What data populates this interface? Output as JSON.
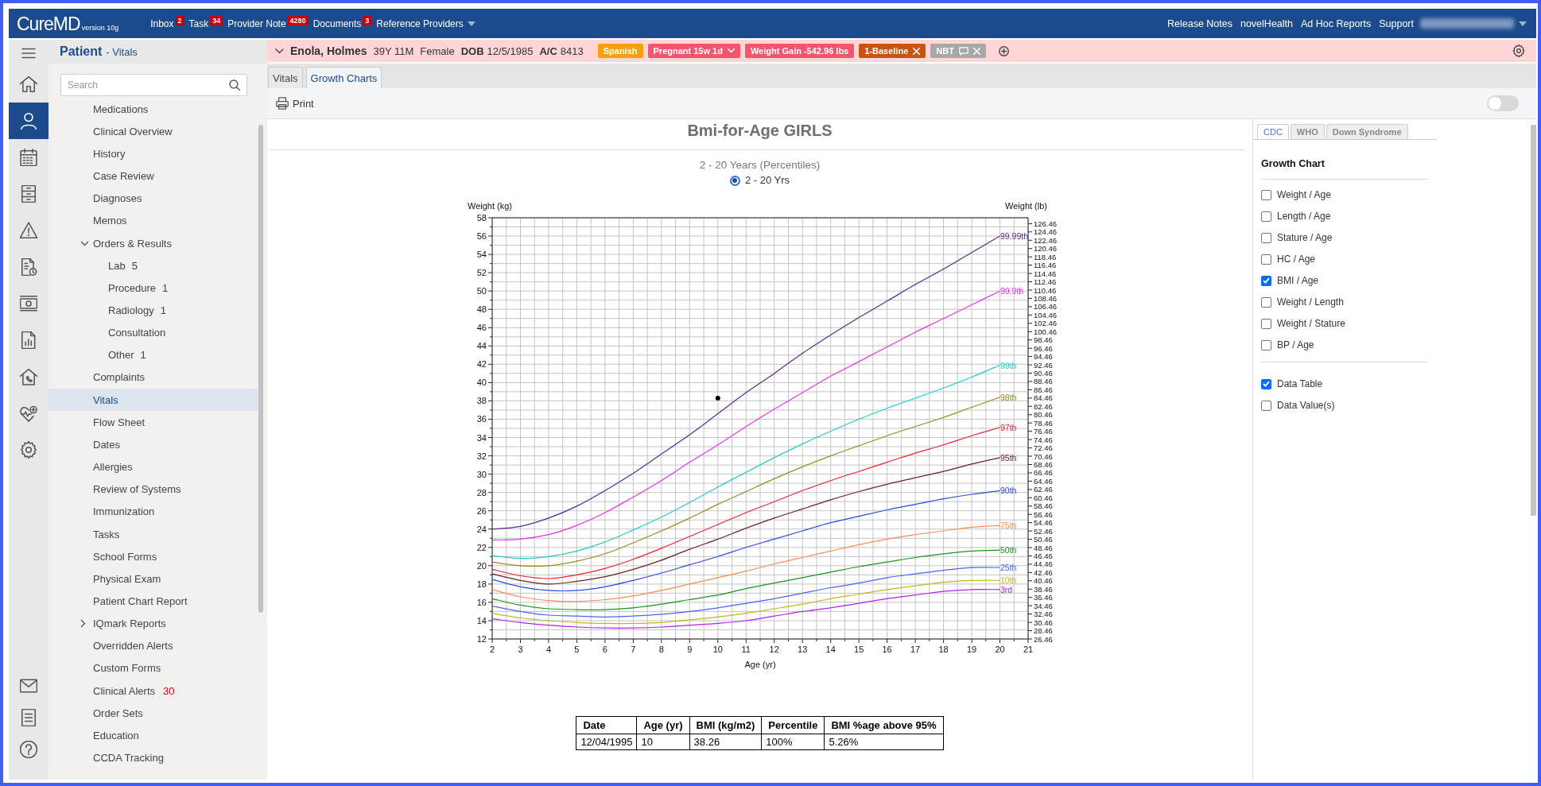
{
  "header": {
    "logo": {
      "name": "CureMD",
      "version": "version 10g"
    },
    "nav": [
      {
        "kind": "counter",
        "label": "Inbox",
        "count": "2"
      },
      {
        "kind": "counter",
        "label": "Task",
        "count": "34"
      },
      {
        "kind": "counter",
        "label": "Provider Note",
        "count": "4280"
      },
      {
        "kind": "counter",
        "label": "Documents",
        "count": "3"
      },
      {
        "kind": "menu",
        "label": "Reference Providers"
      }
    ],
    "links": [
      "Release Notes",
      "novelHealth",
      "Ad Hoc Reports",
      "Support"
    ]
  },
  "nav_rail": {
    "top": [
      {
        "selected": false
      },
      {
        "selected": true
      },
      {
        "selected": false
      },
      {
        "selected": false
      },
      {
        "selected": false
      },
      {
        "selected": false
      },
      {
        "selected": false
      },
      {
        "selected": false
      },
      {
        "selected": false
      },
      {
        "selected": false
      },
      {
        "selected": false
      }
    ],
    "bottom": [
      {
        "selected": false
      },
      {
        "selected": false
      },
      {
        "selected": false
      }
    ]
  },
  "sidebar": {
    "title": "Patient",
    "subtitle": "- Vitals",
    "search": {
      "placeholder": "Search"
    },
    "items": [
      {
        "label": "Medications",
        "selected": false
      },
      {
        "label": "Clinical Overview",
        "selected": false
      },
      {
        "label": "History",
        "selected": false
      },
      {
        "label": "Case Review",
        "selected": false
      },
      {
        "label": "Diagnoses",
        "selected": false
      },
      {
        "label": "Memos",
        "selected": false
      },
      {
        "label": "Orders & Results",
        "selected": false,
        "expanded": true,
        "children": [
          {
            "label": "Lab",
            "count": "5",
            "selected": false
          },
          {
            "label": "Procedure",
            "count": "1",
            "selected": false
          },
          {
            "label": "Radiology",
            "count": "1",
            "selected": false
          },
          {
            "label": "Consultation",
            "selected": false
          },
          {
            "label": "Other",
            "count": "1",
            "selected": false
          }
        ]
      },
      {
        "label": "Complaints",
        "selected": false
      },
      {
        "label": "Vitals",
        "selected": true
      },
      {
        "label": "Flow Sheet",
        "selected": false
      },
      {
        "label": "Dates",
        "selected": false
      },
      {
        "label": "Allergies",
        "selected": false
      },
      {
        "label": "Review of Systems",
        "selected": false
      },
      {
        "label": "Immunization",
        "selected": false
      },
      {
        "label": "Tasks",
        "selected": false
      },
      {
        "label": "School Forms",
        "selected": false
      },
      {
        "label": "Physical Exam",
        "selected": false
      },
      {
        "label": "Patient Chart Report",
        "selected": false
      },
      {
        "label": "IQmark Reports",
        "selected": false,
        "expanded": false
      },
      {
        "label": "Overridden Alerts",
        "selected": false
      },
      {
        "label": "Custom Forms",
        "selected": false
      },
      {
        "label": "Clinical Alerts",
        "alert_count": "30",
        "selected": false
      },
      {
        "label": "Order Sets",
        "selected": false
      },
      {
        "label": "Education",
        "selected": false
      },
      {
        "label": "CCDA Tracking",
        "selected": false
      }
    ]
  },
  "patient": {
    "name": "Enola, Holmes",
    "age": "39Y 11M",
    "sex": "Female",
    "dob_label": "DOB",
    "dob": "12/5/1985",
    "account_label": "A/C",
    "account": "8413",
    "tags": [
      {
        "kind": "plain",
        "label": "Spanish",
        "color": "#f5a00c"
      },
      {
        "kind": "dropdown",
        "label": "Pregnant 15w 1d",
        "color": "#f2556d"
      },
      {
        "kind": "plain",
        "label": "Weight Gain -542.96 lbs",
        "color": "#f2556d"
      },
      {
        "kind": "removable",
        "label": "1-Baseline",
        "color": "#c9540f"
      },
      {
        "kind": "note",
        "label": "NBT",
        "color": "#a8a8a8"
      }
    ]
  },
  "tabs": [
    {
      "label": "Vitals",
      "selected": false
    },
    {
      "label": "Growth Charts",
      "selected": true
    }
  ],
  "toolbar": {
    "print": "Print",
    "toggle": {
      "on": false
    }
  },
  "growth_chart": {
    "heading": "Bmi-for-Age GIRLS",
    "subtitle": "2 - 20 Years (Percentiles)",
    "ranges": [
      {
        "label": "2 - 20 Yrs",
        "selected": true
      }
    ],
    "chart_data": {
      "type": "line",
      "grid": true,
      "xlabel": "Age (yr)",
      "ylabel": "Weight (kg)",
      "x": [
        2,
        3,
        4,
        5,
        6,
        7,
        8,
        9,
        10,
        11,
        12,
        13,
        14,
        15,
        16,
        17,
        18,
        19,
        20
      ],
      "series": [
        {
          "name": "99.99th",
          "color": "#5c2a8e",
          "values": [
            24.0,
            24.3,
            25.2,
            26.5,
            28.2,
            30.1,
            32.2,
            34.3,
            36.6,
            38.9,
            41.0,
            43.2,
            45.2,
            47.1,
            48.9,
            50.7,
            52.4,
            54.2,
            56.0
          ]
        },
        {
          "name": "99.9th",
          "color": "#f030f0",
          "values": [
            22.8,
            22.9,
            23.4,
            24.4,
            25.8,
            27.5,
            29.3,
            31.3,
            33.2,
            35.2,
            37.1,
            38.9,
            40.7,
            42.3,
            43.9,
            45.5,
            47.0,
            48.5,
            50.0
          ]
        },
        {
          "name": "99th",
          "color": "#22cccc",
          "values": [
            21.1,
            20.8,
            21.0,
            21.6,
            22.6,
            23.9,
            25.3,
            26.9,
            28.6,
            30.2,
            31.8,
            33.3,
            34.7,
            36.0,
            37.2,
            38.3,
            39.4,
            40.6,
            41.9
          ]
        },
        {
          "name": "98th",
          "color": "#9a8a22",
          "values": [
            20.4,
            20.0,
            20.0,
            20.5,
            21.3,
            22.5,
            23.8,
            25.2,
            26.7,
            28.1,
            29.5,
            30.8,
            32.0,
            33.1,
            34.2,
            35.2,
            36.2,
            37.3,
            38.4
          ]
        },
        {
          "name": "97th",
          "color": "#f02030",
          "values": [
            19.6,
            18.9,
            18.6,
            19.0,
            19.7,
            20.7,
            21.9,
            23.2,
            24.5,
            25.8,
            27.0,
            28.2,
            29.3,
            30.3,
            31.3,
            32.3,
            33.2,
            34.2,
            35.1
          ]
        },
        {
          "name": "95th",
          "color": "#6e2222",
          "values": [
            19.1,
            18.4,
            18.0,
            18.3,
            18.8,
            19.6,
            20.6,
            21.8,
            22.9,
            24.1,
            25.2,
            26.2,
            27.2,
            28.1,
            28.9,
            29.6,
            30.3,
            31.1,
            31.8
          ]
        },
        {
          "name": "90th",
          "color": "#2a4ae8",
          "values": [
            18.5,
            17.7,
            17.3,
            17.3,
            17.7,
            18.4,
            19.2,
            20.1,
            21.0,
            22.0,
            22.9,
            23.8,
            24.7,
            25.4,
            26.1,
            26.7,
            27.3,
            27.8,
            28.2
          ]
        },
        {
          "name": "75th",
          "color": "#ff8c50",
          "values": [
            17.4,
            16.6,
            16.2,
            16.1,
            16.3,
            16.7,
            17.3,
            18.0,
            18.7,
            19.4,
            20.2,
            20.9,
            21.6,
            22.3,
            22.9,
            23.4,
            23.8,
            24.2,
            24.4
          ]
        },
        {
          "name": "50th",
          "color": "#1a961a",
          "values": [
            16.4,
            15.7,
            15.3,
            15.2,
            15.2,
            15.4,
            15.8,
            16.3,
            16.8,
            17.5,
            18.1,
            18.7,
            19.3,
            19.9,
            20.4,
            20.9,
            21.3,
            21.6,
            21.7
          ]
        },
        {
          "name": "25th",
          "color": "#4a64f0",
          "values": [
            15.6,
            15.0,
            14.6,
            14.5,
            14.4,
            14.5,
            14.7,
            15.0,
            15.4,
            15.9,
            16.4,
            17.0,
            17.6,
            18.1,
            18.7,
            19.1,
            19.5,
            19.8,
            19.8
          ]
        },
        {
          "name": "10th",
          "color": "#c0b820",
          "values": [
            14.8,
            14.3,
            14.0,
            13.8,
            13.7,
            13.7,
            13.8,
            14.1,
            14.4,
            14.8,
            15.3,
            15.8,
            16.4,
            16.9,
            17.4,
            17.8,
            18.2,
            18.4,
            18.4
          ]
        },
        {
          "name": "3rd",
          "color": "#b020f0",
          "values": [
            14.2,
            13.8,
            13.5,
            13.3,
            13.2,
            13.2,
            13.3,
            13.5,
            13.7,
            14.0,
            14.5,
            15.0,
            15.4,
            15.9,
            16.4,
            16.8,
            17.2,
            17.4,
            17.4
          ]
        },
        {
          "color": "#000000",
          "marker": "circle",
          "values": [
            null,
            null,
            null,
            null,
            null,
            null,
            null,
            null,
            38.3,
            null,
            null,
            null,
            null,
            null,
            null,
            null,
            null,
            null,
            null
          ]
        }
      ],
      "xlim": [
        2,
        21
      ],
      "ylim": [
        12,
        58
      ],
      "xticks": [
        2,
        3,
        4,
        5,
        6,
        7,
        8,
        9,
        10,
        11,
        12,
        13,
        14,
        15,
        16,
        17,
        18,
        19,
        20,
        21
      ],
      "yticks": [
        12,
        14,
        16,
        18,
        20,
        22,
        24,
        26,
        28,
        30,
        32,
        34,
        36,
        38,
        40,
        42,
        44,
        46,
        48,
        50,
        52,
        54,
        56,
        58
      ]
    },
    "right_axis": {
      "label": "Weight (lb)",
      "ticks": [
        "126.46",
        "124.46",
        "122.46",
        "120.46",
        "118.46",
        "116.46",
        "114.46",
        "112.46",
        "110.46",
        "108.46",
        "106.46",
        "104.46",
        "102.46",
        "100.46",
        "98.46",
        "96.46",
        "94.46",
        "92.46",
        "90.46",
        "88.46",
        "86.46",
        "84.46",
        "82.46",
        "80.46",
        "78.46",
        "76.46",
        "74.46",
        "72.46",
        "70.46",
        "68.46",
        "66.46",
        "64.46",
        "62.46",
        "60.46",
        "58.46",
        "56.46",
        "54.46",
        "52.46",
        "50.46",
        "48.46",
        "46.46",
        "44.46",
        "42.46",
        "40.46",
        "38.46",
        "36.46",
        "34.46",
        "32.46",
        "30.46",
        "28.46",
        "26.46"
      ]
    }
  },
  "data_table": {
    "columns": [
      "Date",
      "Age (yr)",
      "BMI (kg/m2)",
      "Percentile",
      "BMI %age above 95%"
    ],
    "rows": [
      [
        "12/04/1995",
        "10",
        "38.26",
        "100%",
        "5.26%"
      ]
    ]
  },
  "options_panel": {
    "tabs": [
      {
        "label": "CDC",
        "selected": true
      },
      {
        "label": "WHO",
        "selected": false
      },
      {
        "label": "Down Syndrome",
        "selected": false
      }
    ],
    "title": "Growth Chart",
    "charts": [
      {
        "label": "Weight / Age",
        "checked": false
      },
      {
        "label": "Length / Age",
        "checked": false
      },
      {
        "label": "Stature / Age",
        "checked": false
      },
      {
        "label": "HC / Age",
        "checked": false
      },
      {
        "label": "BMI / Age",
        "checked": true
      },
      {
        "label": "Weight / Length",
        "checked": false
      },
      {
        "label": "Weight / Stature",
        "checked": false
      },
      {
        "label": "BP / Age",
        "checked": false
      }
    ],
    "options": [
      {
        "label": "Data Table",
        "checked": true
      },
      {
        "label": "Data Value(s)",
        "checked": false
      }
    ]
  }
}
